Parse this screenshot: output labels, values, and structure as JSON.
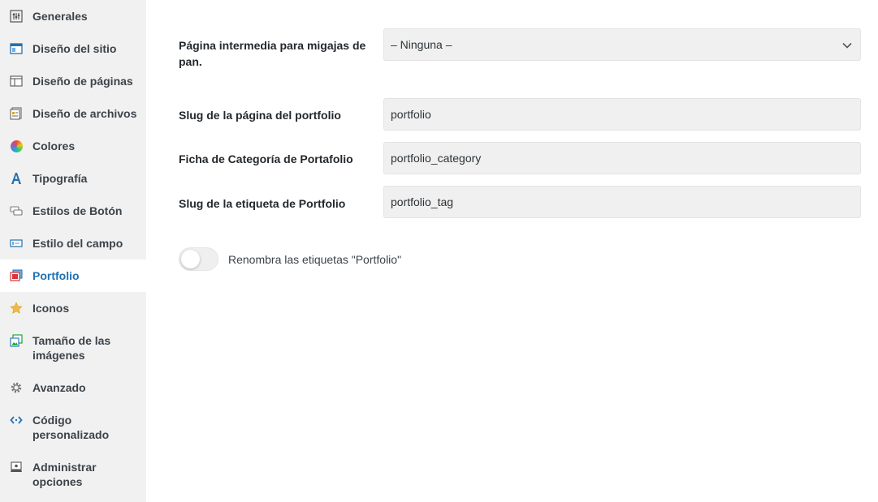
{
  "sidebar": {
    "items": [
      {
        "label": "Generales",
        "icon": "sliders-icon"
      },
      {
        "label": "Diseño del sitio",
        "icon": "site-layout-icon"
      },
      {
        "label": "Diseño de páginas",
        "icon": "page-layout-icon"
      },
      {
        "label": "Diseño de archivos",
        "icon": "archive-layout-icon"
      },
      {
        "label": "Colores",
        "icon": "color-wheel-icon"
      },
      {
        "label": "Tipografía",
        "icon": "typography-icon"
      },
      {
        "label": "Estilos de Botón",
        "icon": "button-styles-icon"
      },
      {
        "label": "Estilo del campo",
        "icon": "field-style-icon"
      },
      {
        "label": "Portfolio",
        "icon": "portfolio-icon",
        "active": true
      },
      {
        "label": "Iconos",
        "icon": "star-icon"
      },
      {
        "label": "Tamaño de las imágenes",
        "icon": "image-size-icon"
      },
      {
        "label": "Avanzado",
        "icon": "gear-icon"
      },
      {
        "label": "Código personalizado",
        "icon": "code-icon"
      },
      {
        "label": "Administrar opciones",
        "icon": "manage-options-icon"
      }
    ]
  },
  "form": {
    "breadcrumb_label": "Página intermedia para migajas de pan.",
    "breadcrumb_value": "– Ninguna –",
    "slug_label": "Slug de la página del portfolio",
    "slug_value": "portfolio",
    "category_label": "Ficha de Categoría de Portafolio",
    "category_value": "portfolio_category",
    "tag_label": "Slug de la etiqueta de Portfolio",
    "tag_value": "portfolio_tag",
    "rename_label": "Renombra las etiquetas \"Portfolio\"",
    "rename_enabled": false
  },
  "colors": {
    "active": "#2271b1",
    "sidebar_bg": "#f1f1f1",
    "field_bg": "#f0f0f0"
  }
}
